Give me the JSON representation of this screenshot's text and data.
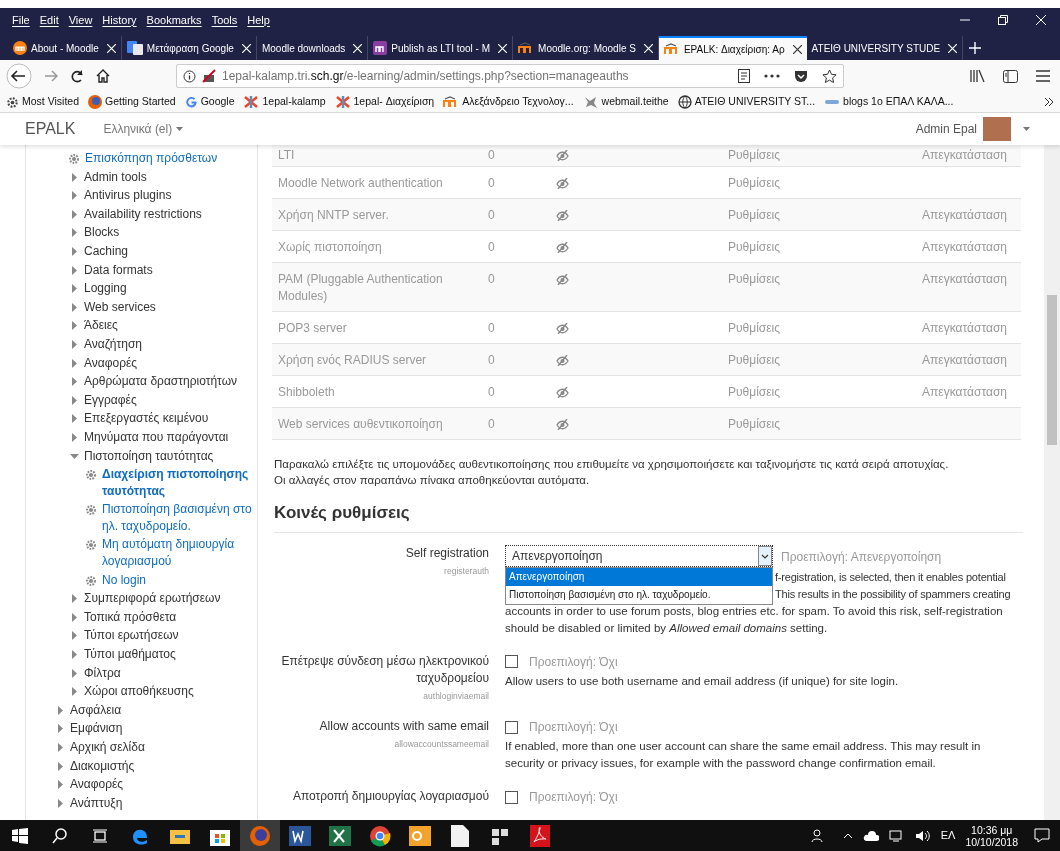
{
  "browser": {
    "menu": [
      "File",
      "Edit",
      "View",
      "History",
      "Bookmarks",
      "Tools",
      "Help"
    ],
    "tabs": [
      {
        "title": "About - Moodle",
        "selected": false
      },
      {
        "title": "Μετάφραση Google",
        "selected": false
      },
      {
        "title": "Moodle downloads",
        "selected": false
      },
      {
        "title": "Publish as LTI tool - M",
        "selected": false
      },
      {
        "title": "Moodle.org: Moodle S",
        "selected": false
      },
      {
        "title": "EPALK: Διαχείριση: Αρ",
        "selected": true
      },
      {
        "title": "ATEIΘ UNIVERSITY STUDE",
        "selected": false
      }
    ],
    "url": {
      "host_start": "1epal-kalamp.tri.",
      "domain": "sch.gr",
      "path": "/e-learning/admin/settings.php?section=manageauths"
    },
    "bookmarks": [
      "Most Visited",
      "Getting Started",
      "Google",
      "1epal-kalamp",
      "1epal- Διαχείριση",
      "Αλεξάνδρειο Τεχνολογ...",
      "webmail.teithe",
      "ATEIΘ UNIVERSITY ST...",
      "blogs 1ο ΕΠΑΛ ΚΑΛΑ..."
    ]
  },
  "navbar": {
    "brand": "EPALK",
    "language": "Ελληνικά (el)",
    "user": "Admin Epal"
  },
  "sidebar": {
    "subitems": [
      {
        "kind": "link",
        "label": "Επισκόπηση πρόσθετων",
        "selected": false
      },
      {
        "kind": "node",
        "label": "Admin tools",
        "expanded": false
      },
      {
        "kind": "node",
        "label": "Antivirus plugins",
        "expanded": false
      },
      {
        "kind": "node",
        "label": "Availability restrictions",
        "expanded": false
      },
      {
        "kind": "node",
        "label": "Blocks",
        "expanded": false
      },
      {
        "kind": "node",
        "label": "Caching",
        "expanded": false
      },
      {
        "kind": "node",
        "label": "Data formats",
        "expanded": false
      },
      {
        "kind": "node",
        "label": "Logging",
        "expanded": false
      },
      {
        "kind": "node",
        "label": "Web services",
        "expanded": false
      },
      {
        "kind": "node",
        "label": "Άδειες",
        "expanded": false
      },
      {
        "kind": "node",
        "label": "Αναζήτηση",
        "expanded": false
      },
      {
        "kind": "node",
        "label": "Αναφορές",
        "expanded": false
      },
      {
        "kind": "node",
        "label": "Αρθρώματα δραστηριοτήτων",
        "expanded": false
      },
      {
        "kind": "node",
        "label": "Εγγραφές",
        "expanded": false
      },
      {
        "kind": "node",
        "label": "Επεξεργαστές κειμένου",
        "expanded": false
      },
      {
        "kind": "node",
        "label": "Μηνύματα που παράγονται",
        "expanded": false
      },
      {
        "kind": "node",
        "label": "Πιστοποίηση ταυτότητας",
        "expanded": true,
        "children": [
          {
            "kind": "link",
            "label": "Διαχείριση πιστοποίησης ταυτότητας",
            "selected": true
          },
          {
            "kind": "link",
            "label": "Πιστοποίηση βασισμένη στο ηλ. ταχυδρομείο.",
            "selected": false
          },
          {
            "kind": "link",
            "label": "Μη αυτόματη δημιουργία λογαριασμού",
            "selected": false
          },
          {
            "kind": "link",
            "label": "No login",
            "selected": false
          }
        ]
      },
      {
        "kind": "node",
        "label": "Συμπεριφορά ερωτήσεων",
        "expanded": false
      },
      {
        "kind": "node",
        "label": "Τοπικά πρόσθετα",
        "expanded": false
      },
      {
        "kind": "node",
        "label": "Τύποι ερωτήσεων",
        "expanded": false
      },
      {
        "kind": "node",
        "label": "Τύποι μαθήματος",
        "expanded": false
      },
      {
        "kind": "node",
        "label": "Φίλτρα",
        "expanded": false
      },
      {
        "kind": "node",
        "label": "Χώροι αποθήκευσης",
        "expanded": false
      }
    ],
    "items": [
      {
        "kind": "node",
        "label": "Ασφάλεια",
        "expanded": false
      },
      {
        "kind": "node",
        "label": "Εμφάνιση",
        "expanded": false
      },
      {
        "kind": "node",
        "label": "Αρχική σελίδα",
        "expanded": false
      },
      {
        "kind": "node",
        "label": "Διακομιστής",
        "expanded": false
      },
      {
        "kind": "node",
        "label": "Αναφορές",
        "expanded": false
      },
      {
        "kind": "node",
        "label": "Ανάπτυξη",
        "expanded": false
      }
    ]
  },
  "auth_table": {
    "rows": [
      {
        "name": "LTI",
        "users": "0",
        "enabled": false,
        "settings": "Ρυθμίσεις",
        "uninstall": "Απεγκατάσταση"
      },
      {
        "name": "Moodle Network authentication",
        "users": "0",
        "enabled": false,
        "settings": "Ρυθμίσεις"
      },
      {
        "name": "Χρήση NNTP server.",
        "users": "0",
        "enabled": false,
        "settings": "Ρυθμίσεις",
        "uninstall": "Απεγκατάσταση"
      },
      {
        "name": "Χωρίς πιστοποίηση",
        "users": "0",
        "enabled": false,
        "settings": "Ρυθμίσεις",
        "uninstall": "Απεγκατάσταση"
      },
      {
        "name": "PAM (Pluggable Authentication Modules)",
        "users": "0",
        "enabled": false,
        "settings": "Ρυθμίσεις",
        "uninstall": "Απεγκατάσταση"
      },
      {
        "name": "POP3 server",
        "users": "0",
        "enabled": false,
        "settings": "Ρυθμίσεις",
        "uninstall": "Απεγκατάσταση"
      },
      {
        "name": "Χρήση ενός RADIUS server",
        "users": "0",
        "enabled": false,
        "settings": "Ρυθμίσεις",
        "uninstall": "Απεγκατάσταση"
      },
      {
        "name": "Shibboleth",
        "users": "0",
        "enabled": false,
        "settings": "Ρυθμίσεις",
        "uninstall": "Απεγκατάσταση"
      },
      {
        "name": "Web services αυθεντικοποίηση",
        "users": "0",
        "enabled": false,
        "settings": "Ρυθμίσεις"
      }
    ]
  },
  "intro": [
    "Παρακαλώ επιλέξτε τις υπομονάδες αυθεντικοποίησης που επιθυμείτε να χρησιμοποιήσετε και ταξινομήστε τις κατά σειρά αποτυχίας.",
    "Οι αλλαγές στον παραπάνω πίνακα αποθηκεύονται αυτόματα."
  ],
  "section_title": "Κοινές ρυθμίσεις",
  "settings": [
    {
      "kind": "select",
      "label": "Self registration",
      "key": "registerauth",
      "value": "Απενεργοποίηση",
      "default": "Προεπιλογή: Απενεργοποίηση",
      "options": [
        {
          "label": "Απενεργοποίηση",
          "selected": true
        },
        {
          "label": "Πιστοποίηση βασισμένη στο ηλ. ταχυδρομείο.",
          "selected": false
        }
      ],
      "description_beside": [
        "f-registration, is selected, then it enables potential",
        "This results in the possibility of spammers creating"
      ],
      "description": "accounts in order to use forum posts, blog entries etc. for spam. To avoid this risk, self-registration should be disabled or limited by *Allowed email domains* setting."
    },
    {
      "kind": "checkbox",
      "label": "Επέτρεψε σύνδεση μέσω ηλεκτρονικού ταχυδρομείου",
      "key": "authloginviaemail",
      "checked": false,
      "default": "Προεπιλογή: Όχι",
      "description": "Allow users to use both username and email address (if unique) for site login."
    },
    {
      "kind": "checkbox",
      "label": "Allow accounts with same email",
      "key": "allowaccountssameemail",
      "checked": false,
      "default": "Προεπιλογή: Όχι",
      "description": "If enabled, more than one user account can share the same email address. This may result in security or privacy issues, for example with the password change confirmation email."
    },
    {
      "kind": "checkbox",
      "label": "Αποτροπή δημιουργίας λογαριασμού",
      "checked": false,
      "default": "Προεπιλογή: Όχι"
    }
  ],
  "taskbar": {
    "language": "ΕΛ",
    "time": "10:36 μμ",
    "date": "10/10/2018"
  }
}
